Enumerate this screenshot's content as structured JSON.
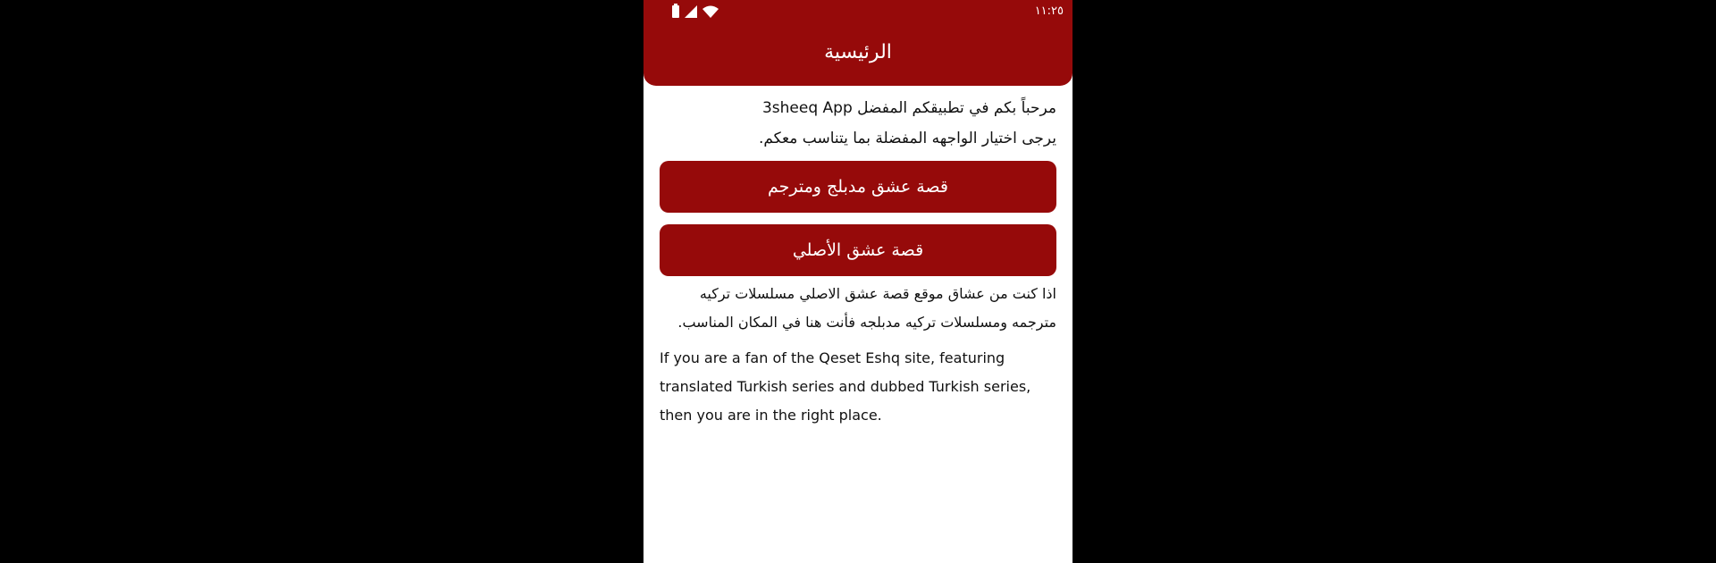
{
  "status_bar": {
    "time": "١١:٢٥",
    "icons": [
      "battery-icon",
      "signal-icon",
      "wifi-icon"
    ]
  },
  "appbar": {
    "title": "الرئيسية"
  },
  "welcome": {
    "line1": "مرحباً بكم في تطبيقكم المفضل 3sheeq App",
    "line2": "يرجى اختيار الواجهه المفضلة بما يتناسب معكم."
  },
  "buttons": {
    "dubbed_translated": "قصة عشق مدبلج ومترجم",
    "original": "قصة عشق الأصلي"
  },
  "description": {
    "arabic_line1": "اذا كنت من عشاق موقع قصة عشق الاصلي مسلسلات تركيه",
    "arabic_line2": "مترجمه ومسلسلات تركيه مدبلجه فأنت هنا في المكان المناسب.",
    "english": "If you are a fan of the Qeset Eshq site, featuring translated Turkish series and dubbed Turkish series, then you are in the right place."
  },
  "colors": {
    "brand": "#960a0a",
    "background": "#ffffff",
    "outer": "#000000"
  }
}
